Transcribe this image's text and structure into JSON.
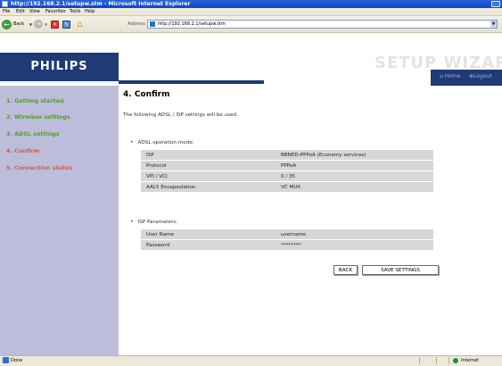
{
  "window": {
    "title": "http://192.168.2.1/setupw.stm - Microsoft Internet Explorer"
  },
  "menubar": [
    "File",
    "Edit",
    "View",
    "Favorites",
    "Tools",
    "Help"
  ],
  "toolbar": {
    "back_label": "Back",
    "address_label": "Address",
    "address_value": "http://192.168.2.1/setupw.stm"
  },
  "header": {
    "logo": "PHILIPS",
    "wizard_title": "SETUP WIZARD",
    "home_link": "Home",
    "logout_link": "Logout"
  },
  "sidebar": {
    "items": [
      {
        "label": "1. Getting started",
        "color": "#55a01f"
      },
      {
        "label": "2. Wireless settings",
        "color": "#55a01f"
      },
      {
        "label": "3. ADSL settings",
        "color": "#55a01f"
      },
      {
        "label": "4. Confirm",
        "color": "#e25a3a"
      },
      {
        "label": "5. Connection status",
        "color": "#e25a3a"
      }
    ]
  },
  "content": {
    "title": "4. Confirm",
    "intro": "The following ADSL / ISP settings will be used.",
    "adsl_heading": "ADSL operation mode:",
    "adsl_rows": [
      {
        "label": "ISP",
        "value": "BBNED-PPPoA (Economy services)"
      },
      {
        "label": "Protocol",
        "value": "PPPoA"
      },
      {
        "label": "VPI / VCI",
        "value": "0 / 35"
      },
      {
        "label": "AAL5 Encapsulation",
        "value": "VC MUX"
      }
    ],
    "isp_heading": "ISP Parameters:",
    "isp_rows": [
      {
        "label": "User Name",
        "value": "username"
      },
      {
        "label": "Password",
        "value": "********"
      }
    ],
    "back_button": "BACK",
    "save_button": "SAVE SETTINGS"
  },
  "statusbar": {
    "status": "Done",
    "zone": "Internet"
  }
}
